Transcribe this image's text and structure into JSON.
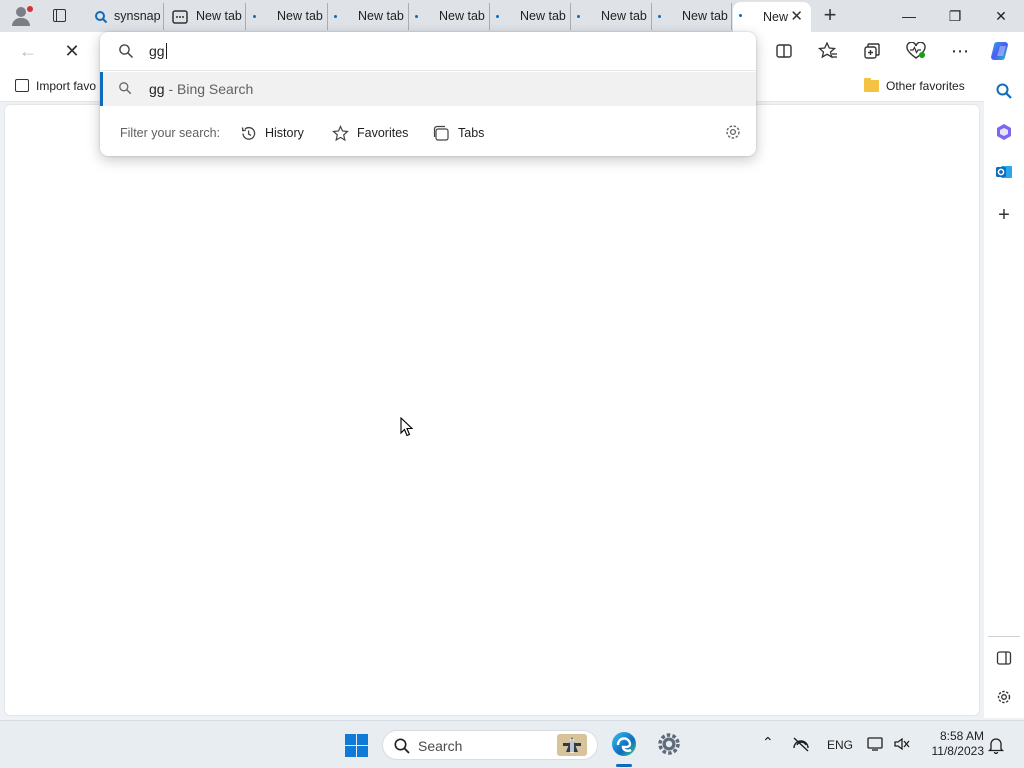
{
  "tabs": [
    {
      "label": "synsnap",
      "icon": "search-icon"
    },
    {
      "label": "New tab",
      "icon": "new-tab-icon"
    },
    {
      "label": "New tab",
      "icon": "dot-icon"
    },
    {
      "label": "New tab",
      "icon": "dot-icon"
    },
    {
      "label": "New tab",
      "icon": "dot-icon"
    },
    {
      "label": "New tab",
      "icon": "dot-icon"
    },
    {
      "label": "New tab",
      "icon": "dot-icon"
    },
    {
      "label": "New tab",
      "icon": "dot-icon"
    },
    {
      "label": "New",
      "icon": "dot-icon",
      "active": true
    }
  ],
  "favorites_bar": {
    "import_label": "Import favo",
    "other_label": "Other favorites"
  },
  "omnibox": {
    "query": "gg",
    "suggestion_query": "gg",
    "suggestion_engine": " - Bing Search",
    "filter_label": "Filter your search:",
    "filters": [
      "History",
      "Favorites",
      "Tabs"
    ]
  },
  "taskbar": {
    "search_label": "Search",
    "language": "ENG",
    "time": "8:58 AM",
    "date": "11/8/2023"
  },
  "colors": {
    "accent": "#0f6cbd",
    "tabstrip": "#dfe3e8",
    "taskbar": "#e8edf2"
  }
}
